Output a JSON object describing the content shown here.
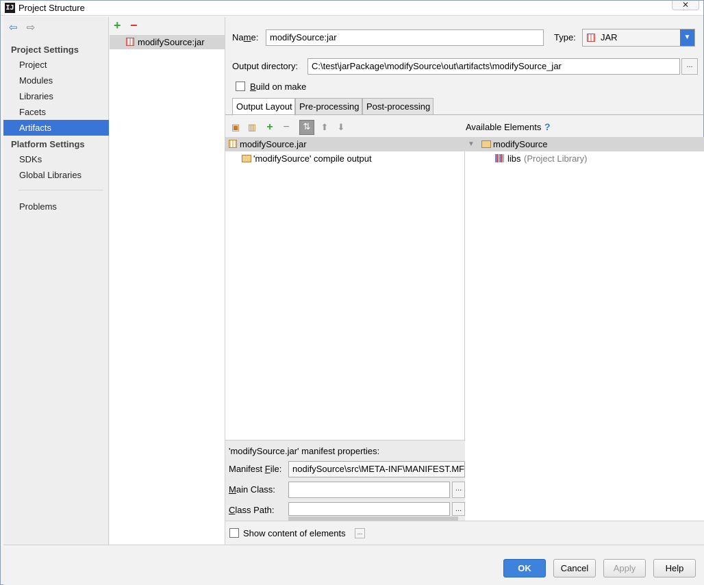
{
  "window": {
    "title": "Project Structure",
    "close_glyph": "✕"
  },
  "nav": {
    "back_glyph": "⇦",
    "forward_glyph": "⇨",
    "project_settings_header": "Project Settings",
    "project_settings_items": [
      "Project",
      "Modules",
      "Libraries",
      "Facets",
      "Artifacts"
    ],
    "selected_item": "Artifacts",
    "platform_settings_header": "Platform Settings",
    "platform_settings_items": [
      "SDKs",
      "Global Libraries"
    ],
    "problems_label": "Problems"
  },
  "artifacts": {
    "add_glyph": "+",
    "remove_glyph": "−",
    "items": [
      "modifySource:jar"
    ]
  },
  "form": {
    "name_label": "Name:",
    "name_value": "modifySource:jar",
    "type_label": "Type:",
    "type_value": "JAR",
    "output_dir_label": "Output directory:",
    "output_dir_value": "C:\\test\\jarPackage\\modifySource\\out\\artifacts\\modifySource_jar",
    "browse_glyph": "...",
    "build_on_make_label": "Build on make",
    "build_on_make_checked": false
  },
  "tabs": [
    "Output Layout",
    "Pre-processing",
    "Post-processing"
  ],
  "active_tab": "Output Layout",
  "layout_tree": {
    "root": "modifySource.jar",
    "children": [
      "'modifySource' compile output"
    ]
  },
  "available": {
    "label": "Available Elements",
    "help_glyph": "?",
    "root": "modifySource",
    "children": [
      {
        "name": "libs",
        "suffix": "(Project Library)"
      }
    ]
  },
  "manifest": {
    "title": "'modifySource.jar' manifest properties:",
    "manifest_file_label": "Manifest File:",
    "manifest_file_value": "nodifySource\\src\\META-INF\\MANIFEST.MF",
    "main_class_label": "Main Class:",
    "main_class_value": "",
    "class_path_label": "Class Path:",
    "class_path_value": ""
  },
  "show_content_label": "Show content of elements",
  "buttons": {
    "ok": "OK",
    "cancel": "Cancel",
    "apply": "Apply",
    "help": "Help"
  },
  "colors": {
    "selection": "#3875d7",
    "primary_button": "#3d83dc",
    "type_dropdown_arrow": "#3a78d6"
  }
}
